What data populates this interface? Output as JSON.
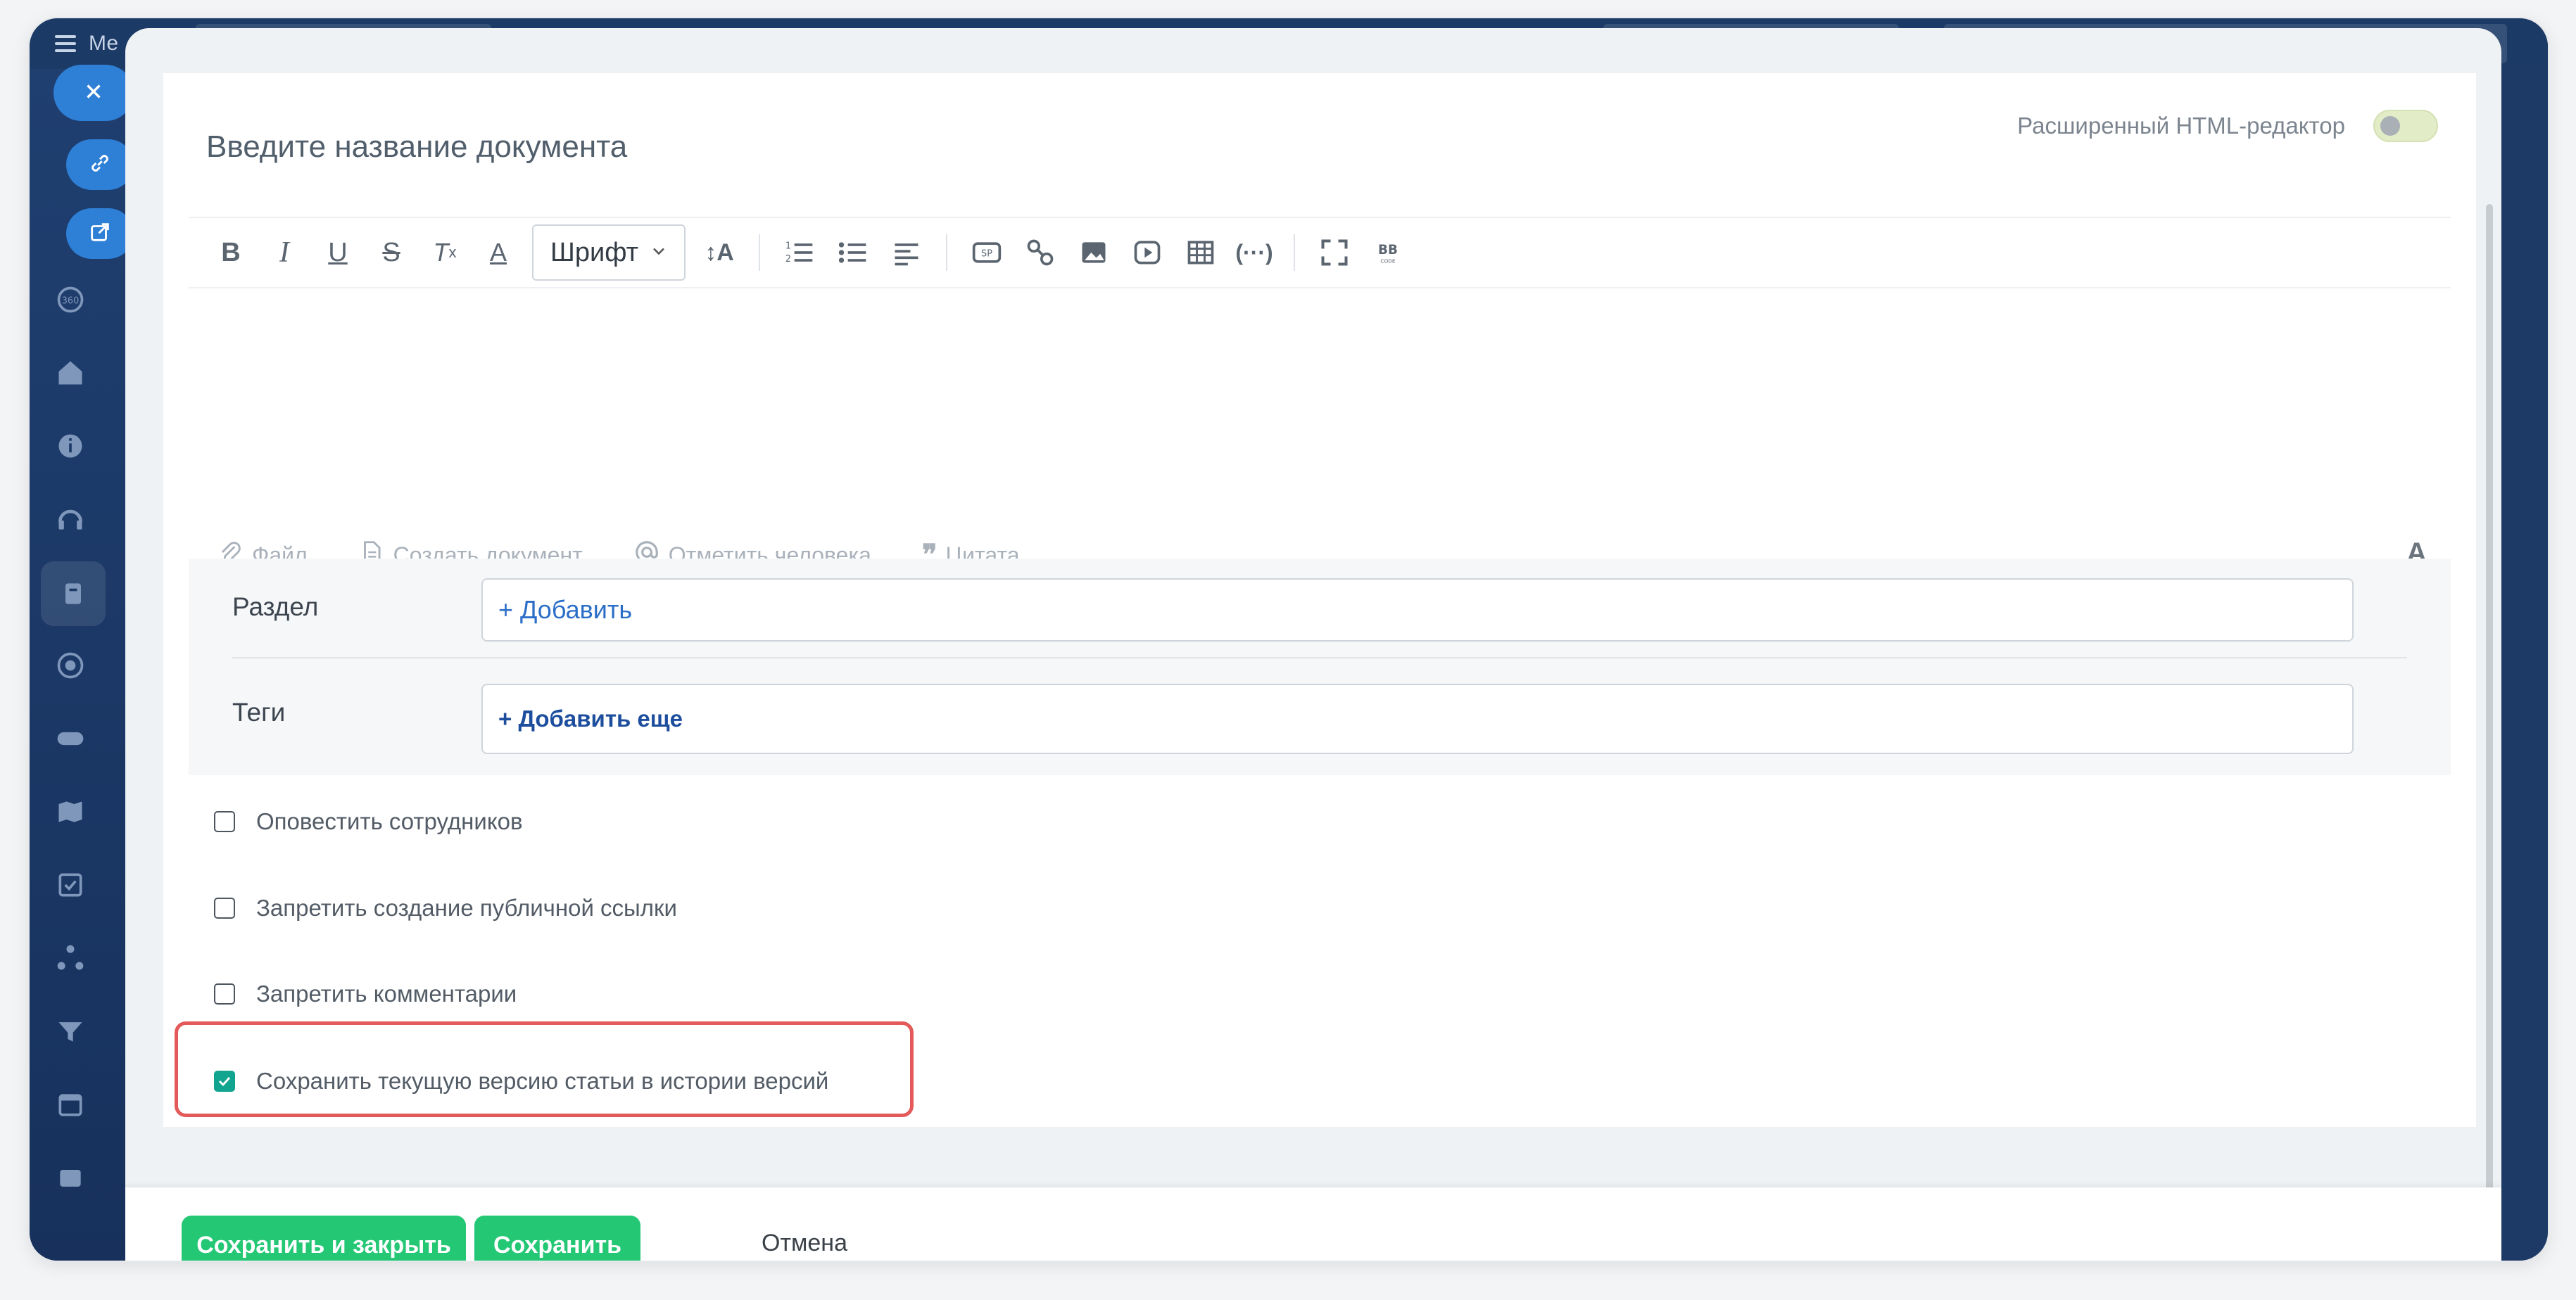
{
  "background_app": {
    "menu_label": "Ме",
    "sidebar_icons": [
      "360-icon",
      "home-icon",
      "info-icon",
      "headset-icon",
      "knowledge-base-icon",
      "target-icon",
      "gamepad-icon",
      "map-icon",
      "tasks-icon",
      "network-icon",
      "funnel-icon",
      "calendar-icon",
      "archive-icon"
    ]
  },
  "fabs": {
    "close": "close-icon",
    "link": "link-icon",
    "open_external": "external-link-icon"
  },
  "document": {
    "title_placeholder": "Введите название документа",
    "html_editor_label": "Расширенный HTML-редактор",
    "html_editor_enabled": false
  },
  "toolbar": {
    "font_select_value": "Шрифт",
    "buttons": [
      "bold",
      "italic",
      "underline",
      "strikethrough",
      "clear-format",
      "font-color",
      "font-size",
      "ordered-list",
      "bulleted-list",
      "align",
      "spoiler",
      "link",
      "image",
      "video",
      "table",
      "code",
      "fullscreen",
      "bbcode"
    ]
  },
  "attach": {
    "file": "Файл",
    "create_doc": "Создать документ",
    "mention": "Отметить человека",
    "quote": "Цитата",
    "text_format": "A"
  },
  "fields": {
    "section_label": "Раздел",
    "section_add": "+ Добавить",
    "tags_label": "Теги",
    "tags_add": "+ Добавить еще"
  },
  "options": [
    {
      "label": "Оповестить сотрудников",
      "checked": false
    },
    {
      "label": "Запретить создание публичной ссылки",
      "checked": false
    },
    {
      "label": "Запретить комментарии",
      "checked": false
    },
    {
      "label": "Сохранить текущую версию статьи в истории версий",
      "checked": true
    }
  ],
  "footer": {
    "save_close": "Сохранить и закрыть",
    "save": "Сохранить",
    "cancel": "Отмена"
  },
  "colors": {
    "accent_green": "#23c774",
    "check_teal": "#11a48f",
    "highlight_red": "#e45959",
    "link_blue": "#2b6ec7"
  }
}
